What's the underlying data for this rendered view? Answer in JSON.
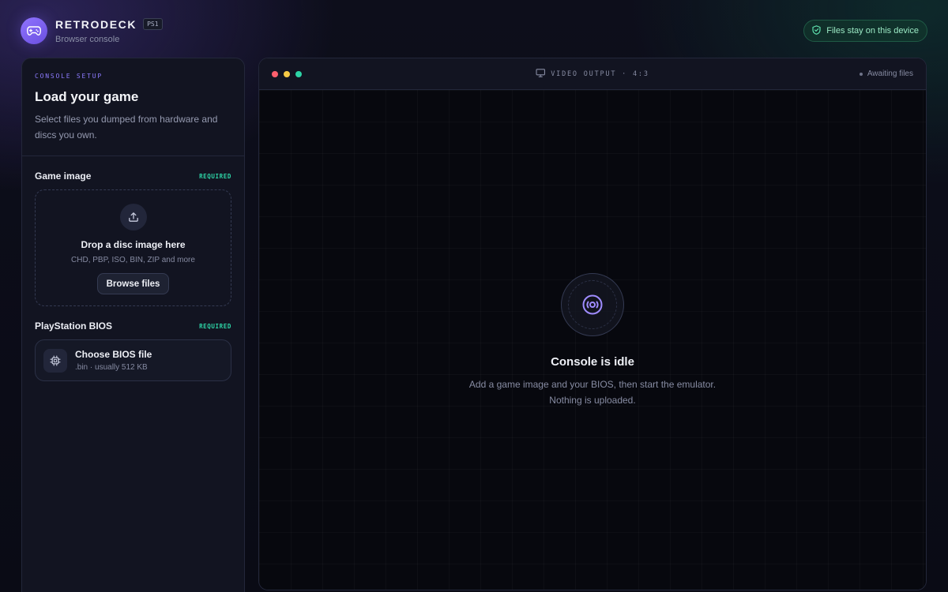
{
  "header": {
    "brand_name": "RETRODECK",
    "badge": "PS1",
    "subtitle": "Browser console",
    "privacy_label": "Files stay on this device",
    "icons": {
      "logo": "gamepad-icon",
      "privacy": "shield-check-icon"
    }
  },
  "sidebar": {
    "eyebrow": "CONSOLE SETUP",
    "title": "Load your game",
    "description": "Select files you dumped from hardware and discs you own.",
    "game_image": {
      "label": "Game image",
      "required_tag": "REQUIRED",
      "drop_title": "Drop a disc image here",
      "formats": "CHD, PBP, ISO, BIN, ZIP and more",
      "browse_label": "Browse files",
      "icon": "upload-icon"
    },
    "bios": {
      "label": "PlayStation BIOS",
      "required_tag": "REQUIRED",
      "choose_title": "Choose BIOS file",
      "hint": ".bin · usually 512 KB",
      "icon": "chip-icon"
    }
  },
  "viewer": {
    "output_label": "VIDEO OUTPUT · 4:3",
    "status": "Awaiting files",
    "idle_title": "Console is idle",
    "idle_line1": "Add a game image and your BIOS, then start the emulator.",
    "idle_line2": "Nothing is uploaded.",
    "window_dots": [
      "#ff5f6d",
      "#f6c945",
      "#2dd4a6"
    ],
    "icons": {
      "monitor": "monitor-icon",
      "disc": "disc-icon"
    }
  },
  "colors": {
    "accent": "#8d7bff",
    "success": "#2dd4a6",
    "background": "#0a0b15"
  }
}
